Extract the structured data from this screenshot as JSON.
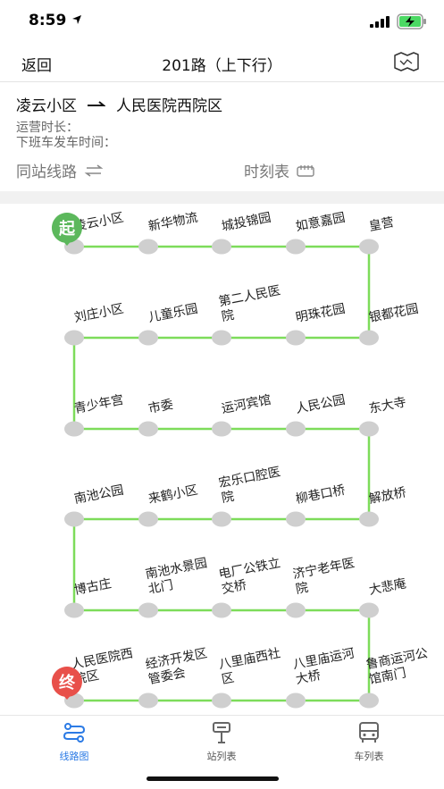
{
  "status_bar": {
    "time": "8:59"
  },
  "nav": {
    "back_label": "返回",
    "title": "201路（上下行）"
  },
  "info": {
    "from": "凌云小区",
    "to": "人民医院西院区",
    "operating_hours_label": "运营时长：",
    "last_bus_label": "下班车发车时间：",
    "same_station_label": "同站线路",
    "timetable_label": "时刻表"
  },
  "badges": {
    "start": "起",
    "end": "终"
  },
  "colors": {
    "line": "#7ddc5a",
    "stop": "#cfcfcf",
    "start_badge": "#5cb85c",
    "end_badge": "#e8504a",
    "accent": "#2c7be5"
  },
  "stops": [
    "凌云小区",
    "新华物流",
    "城投锦园",
    "如意嘉园",
    "皇营",
    "银都花园",
    "明珠花园",
    "第二人民医院",
    "儿童乐园",
    "刘庄小区",
    "青少年宫",
    "市委",
    "运河宾馆",
    "人民公园",
    "东大寺",
    "解放桥",
    "柳巷口桥",
    "宏乐口腔医院",
    "来鹤小区",
    "南池公园",
    "博古庄",
    "南池水景园北门",
    "电厂公铁立交桥",
    "济宁老年医院",
    "大悲庵",
    "鲁商运河公馆南门",
    "八里庙运河大桥",
    "八里庙西社区",
    "经济开发区管委会",
    "人民医院西院区"
  ],
  "tabs": [
    {
      "label": "线路图",
      "icon": "route-map-icon"
    },
    {
      "label": "站列表",
      "icon": "station-list-icon"
    },
    {
      "label": "车列表",
      "icon": "bus-list-icon"
    }
  ]
}
